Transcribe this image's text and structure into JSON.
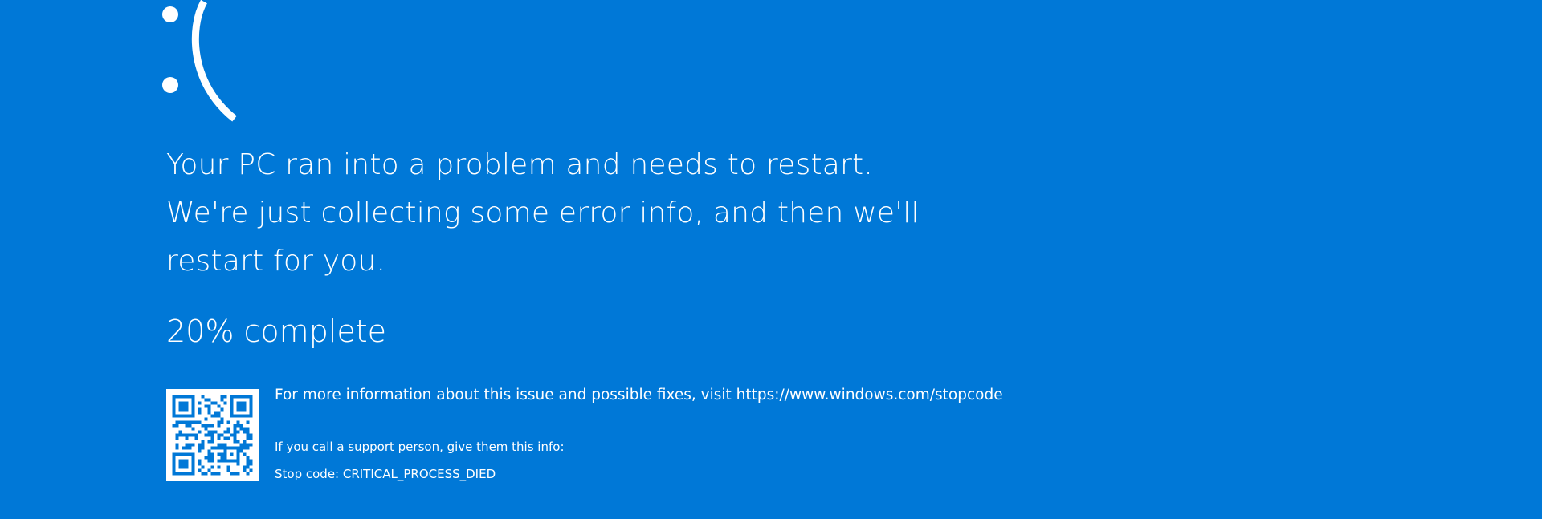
{
  "screen": {
    "emoticon": ":(",
    "emoticon_icon": "sad-face-icon",
    "message": "Your PC ran into a problem and needs to restart. We're just collecting some error info, and then we'll restart for you.",
    "progress_percent": 20,
    "progress_text": "20% complete",
    "info_text": "For more information about this issue and possible fixes, visit https://www.windows.com/stopcode",
    "support_text": "If you call a support person, give them this info:",
    "stop_code_text": "Stop code: CRITICAL_PROCESS_DIED",
    "qr_icon": "qr-code-icon"
  },
  "colors": {
    "background": "#0078d7",
    "text": "#ffffff"
  }
}
